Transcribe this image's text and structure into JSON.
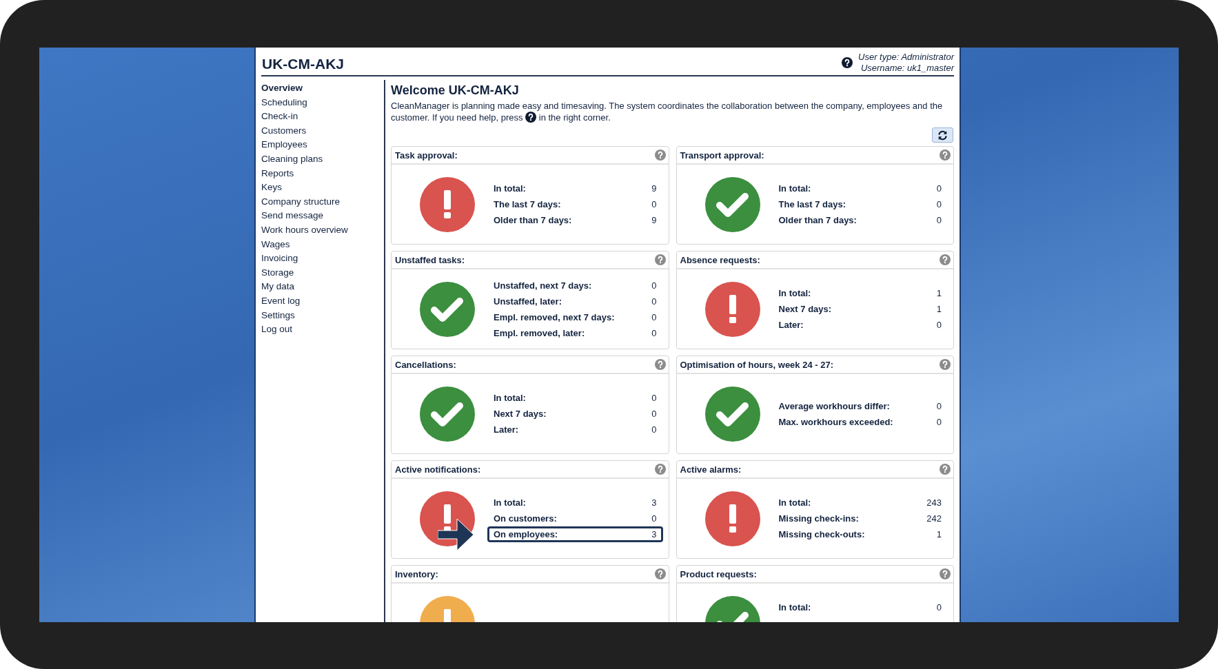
{
  "window": {
    "title": "UK-CM-AKJ",
    "user_type": "User type: Administrator",
    "username": "Username: uk1_master"
  },
  "sidebar": {
    "items": [
      {
        "label": "Overview",
        "selected": true
      },
      {
        "label": "Scheduling",
        "selected": false
      },
      {
        "label": "Check-in",
        "selected": false
      },
      {
        "label": "Customers",
        "selected": false
      },
      {
        "label": "Employees",
        "selected": false
      },
      {
        "label": "Cleaning plans",
        "selected": false
      },
      {
        "label": "Reports",
        "selected": false
      },
      {
        "label": "Keys",
        "selected": false
      },
      {
        "label": "Company structure",
        "selected": false
      },
      {
        "label": "Send message",
        "selected": false
      },
      {
        "label": "Work hours overview",
        "selected": false
      },
      {
        "label": "Wages",
        "selected": false
      },
      {
        "label": "Invoicing",
        "selected": false
      },
      {
        "label": "Storage",
        "selected": false
      },
      {
        "label": "My data",
        "selected": false
      },
      {
        "label": "Event log",
        "selected": false
      },
      {
        "label": "Settings",
        "selected": false
      },
      {
        "label": "Log out",
        "selected": false
      }
    ]
  },
  "main": {
    "heading": "Welcome UK-CM-AKJ",
    "intro_before": "CleanManager is planning made easy and timesaving. The system coordinates the collaboration between the company, employees and the customer. If you need help, press",
    "intro_after": "in the right corner.",
    "cards": [
      {
        "title": "Task approval:",
        "kind": "alert",
        "rows": [
          {
            "label": "In total:",
            "value": "9",
            "highlighted": false
          },
          {
            "label": "The last 7 days:",
            "value": "0",
            "highlighted": false
          },
          {
            "label": "Older than 7 days:",
            "value": "9",
            "highlighted": false
          }
        ]
      },
      {
        "title": "Transport approval:",
        "kind": "ok",
        "rows": [
          {
            "label": "In total:",
            "value": "0",
            "highlighted": false
          },
          {
            "label": "The last 7 days:",
            "value": "0",
            "highlighted": false
          },
          {
            "label": "Older than 7 days:",
            "value": "0",
            "highlighted": false
          }
        ]
      },
      {
        "title": "Unstaffed tasks:",
        "kind": "ok",
        "rows": [
          {
            "label": "Unstaffed, next 7 days:",
            "value": "0",
            "highlighted": false
          },
          {
            "label": "Unstaffed, later:",
            "value": "0",
            "highlighted": false
          },
          {
            "label": "Empl. removed, next 7 days:",
            "value": "0",
            "highlighted": false
          },
          {
            "label": "Empl. removed, later:",
            "value": "0",
            "highlighted": false
          }
        ]
      },
      {
        "title": "Absence requests:",
        "kind": "alert",
        "rows": [
          {
            "label": "In total:",
            "value": "1",
            "highlighted": false
          },
          {
            "label": "Next 7 days:",
            "value": "1",
            "highlighted": false
          },
          {
            "label": "Later:",
            "value": "0",
            "highlighted": false
          }
        ]
      },
      {
        "title": "Cancellations:",
        "kind": "ok",
        "rows": [
          {
            "label": "In total:",
            "value": "0",
            "highlighted": false
          },
          {
            "label": "Next 7 days:",
            "value": "0",
            "highlighted": false
          },
          {
            "label": "Later:",
            "value": "0",
            "highlighted": false
          }
        ]
      },
      {
        "title": "Optimisation of hours, week 24 - 27:",
        "kind": "ok",
        "rows": [
          {
            "label": "Average workhours differ:",
            "value": "0",
            "highlighted": false
          },
          {
            "label": "Max. workhours exceeded:",
            "value": "0",
            "highlighted": false
          }
        ]
      },
      {
        "title": "Active notifications:",
        "kind": "alert",
        "rows": [
          {
            "label": "In total:",
            "value": "3",
            "highlighted": false
          },
          {
            "label": "On customers:",
            "value": "0",
            "highlighted": false
          },
          {
            "label": "On employees:",
            "value": "3",
            "highlighted": true
          }
        ]
      },
      {
        "title": "Active alarms:",
        "kind": "alert",
        "rows": [
          {
            "label": "In total:",
            "value": "243",
            "highlighted": false
          },
          {
            "label": "Missing check-ins:",
            "value": "242",
            "highlighted": false
          },
          {
            "label": "Missing check-outs:",
            "value": "1",
            "highlighted": false
          }
        ]
      },
      {
        "title": "Inventory:",
        "kind": "warning"
      },
      {
        "title": "Product requests:",
        "kind": "ok",
        "rows": [
          {
            "label": "In total:",
            "value": "0",
            "highlighted": false
          }
        ]
      }
    ]
  }
}
